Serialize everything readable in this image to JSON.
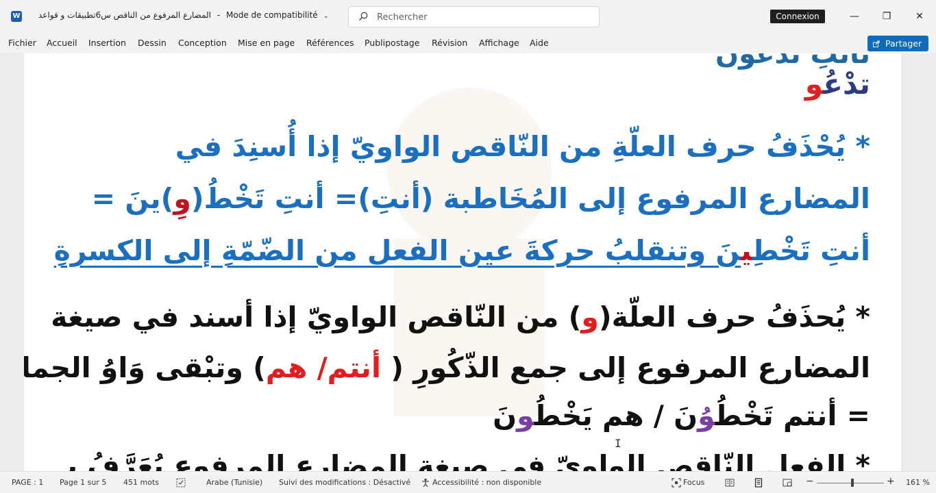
{
  "titlebar": {
    "app_icon_letter": "W",
    "doc_title": "المضارع المرفوع من الناقص س6تطبيقات و قواعد",
    "separator": "-",
    "mode": "Mode de compatibilité",
    "search_placeholder": "Rechercher",
    "connexion_label": "Connexion",
    "minimize_glyph": "—",
    "restore_glyph": "❐",
    "close_glyph": "✕"
  },
  "menu": {
    "items": [
      "Fichier",
      "Accueil",
      "Insertion",
      "Dessin",
      "Conception",
      "Mise en page",
      "Références",
      "Publipostage",
      "Révision",
      "Affichage",
      "Aide"
    ],
    "share_label": "Partager",
    "share_chevron": "⌄"
  },
  "document": {
    "top_partial": "نأنتِ تَدْعُونَ",
    "tadou": {
      "part1": "تدْعُ",
      "part2": "و"
    },
    "para1": {
      "line1": "* يُحْذَفُ حرف العلّةِ من النّاقص الواويّ إذا أُسنِدَ في",
      "line2_a": "المضارع المرفوع إلى المُخَاطبة (أنتِ)= أنتِ تَخْطُ(",
      "line2_red": "وِ",
      "line2_b": ")ينَ =",
      "line3_a": "أنتِ تَخْطِ",
      "line3_red": "ي",
      "line3_b": "نَ وتنقلبُ حركةَ عين الفعل من الضّمّةِ إلى الكسرةِ"
    },
    "para2": {
      "line1_a": "* يُحذَفُ حرف العلّة(",
      "line1_red": "و",
      "line1_b": ") من النّاقص الواويّ إذا أسند في صيغة",
      "line2_a": "المضارع المرفوع إلى جمع الذّكُورِ ( ",
      "line2_red": "أنتم/ هم",
      "line2_b": ") وتبْقى وَاوُ الجماعةِ",
      "line3_a": "= أنتم تَخْطُ",
      "line3_purple1": "وُ",
      "line3_b": "نَ  /  هم يَخْطُ",
      "line3_purple2": "و",
      "line3_c": "نَ"
    },
    "bottom_partial": "* الفعل النّاقص الواويّ في صيغة المضارع المرفوع يُعَرَّفُ بـِ"
  },
  "status": {
    "page": "PAGE : 1",
    "page_of": "Page 1 sur 5",
    "words": "451 mots",
    "language": "Arabe (Tunisie)",
    "track_changes": "Suivi des modifications : Désactivé",
    "accessibility": "Accessibilité : non disponible",
    "focus": "Focus",
    "zoom_minus": "−",
    "zoom_plus": "+",
    "zoom_level": "161 %",
    "zoom_fraction": 0.53
  }
}
